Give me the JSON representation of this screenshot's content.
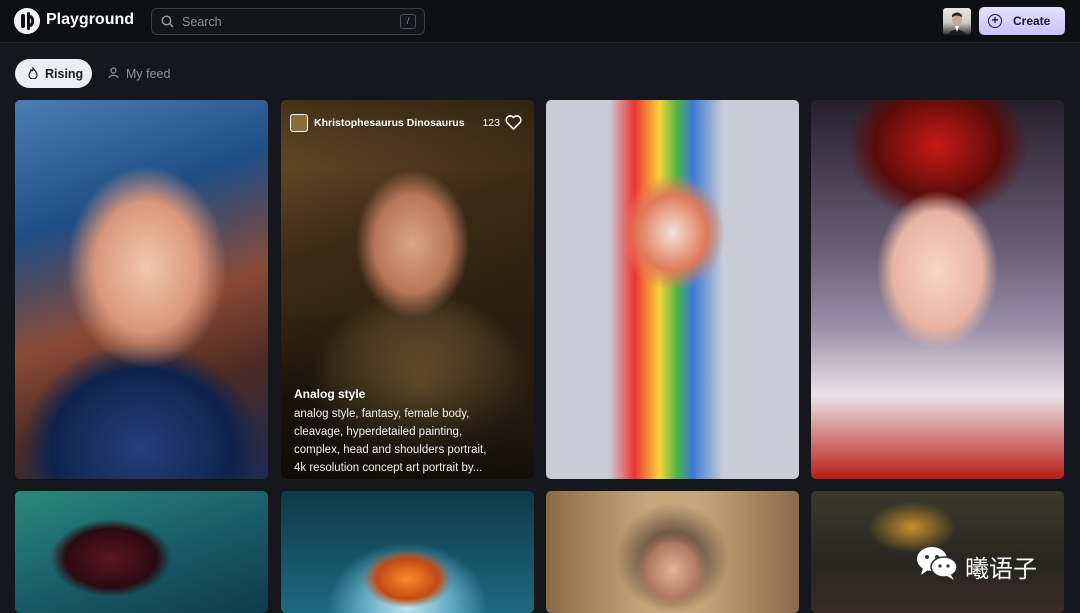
{
  "header": {
    "app_name": "Playground",
    "search_placeholder": "Search",
    "search_shortcut": "/",
    "create_label": "Create"
  },
  "tabs": [
    {
      "label": "Rising",
      "active": true
    },
    {
      "label": "My feed",
      "active": false
    }
  ],
  "feed": {
    "hover_card": {
      "author": "Khristophesaurus Dinosaurus",
      "likes": "123",
      "title": "Analog style",
      "description_lines": [
        "analog style, fantasy, female body,",
        "cleavage, hyperdetailed painting,",
        "complex, head and shoulders portrait,",
        "4k resolution concept art portrait by..."
      ]
    }
  },
  "watermark": {
    "text": "曦语子"
  },
  "colors": {
    "accent": "#c9c2f5",
    "background": "#15171c",
    "topbar": "#0e0f12"
  }
}
